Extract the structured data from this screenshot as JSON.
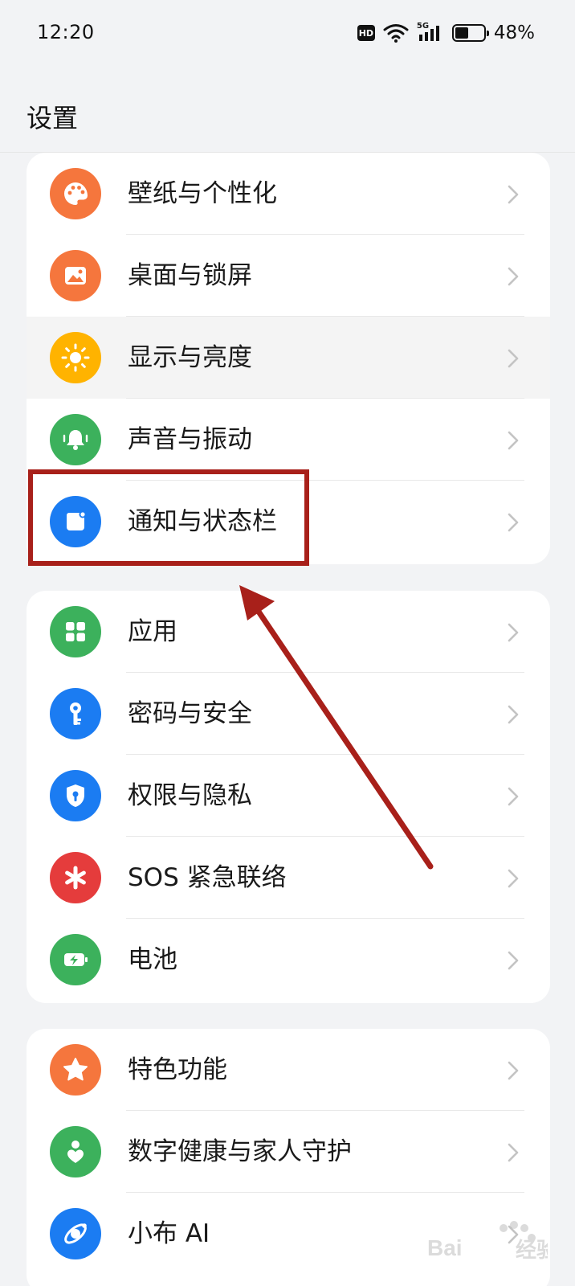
{
  "status_bar": {
    "time": "12:20",
    "network_tag": "5G",
    "hd_tag": "HD",
    "battery_percent": "48%",
    "battery_level": 0.48
  },
  "page": {
    "title": "设置"
  },
  "groups": [
    {
      "items": [
        {
          "label": "壁纸与个性化",
          "icon": "palette-icon",
          "color": "#f5763d"
        },
        {
          "label": "桌面与锁屏",
          "icon": "image-icon",
          "color": "#f5763d"
        },
        {
          "label": "显示与亮度",
          "icon": "sun-icon",
          "color": "#ffb300",
          "pressed": true
        },
        {
          "label": "声音与振动",
          "icon": "bell-icon",
          "color": "#3cb15c"
        },
        {
          "label": "通知与状态栏",
          "icon": "notification-icon",
          "color": "#1b7cf2",
          "highlighted": true
        }
      ]
    },
    {
      "items": [
        {
          "label": "应用",
          "icon": "apps-grid-icon",
          "color": "#3cb15c"
        },
        {
          "label": "密码与安全",
          "icon": "key-icon",
          "color": "#1b7cf2"
        },
        {
          "label": "权限与隐私",
          "icon": "shield-lock-icon",
          "color": "#1b7cf2"
        },
        {
          "label": "SOS 紧急联络",
          "icon": "asterisk-icon",
          "color": "#e53c3c"
        },
        {
          "label": "电池",
          "icon": "battery-charge-icon",
          "color": "#3cb15c"
        }
      ]
    },
    {
      "items": [
        {
          "label": "特色功能",
          "icon": "star-icon",
          "color": "#f5763d"
        },
        {
          "label": "数字健康与家人守护",
          "icon": "family-heart-icon",
          "color": "#3cb15c"
        },
        {
          "label": "小布 AI",
          "icon": "ai-orbit-icon",
          "color": "#1b7cf2"
        }
      ]
    }
  ],
  "annotation": {
    "color": "#a8201a"
  }
}
